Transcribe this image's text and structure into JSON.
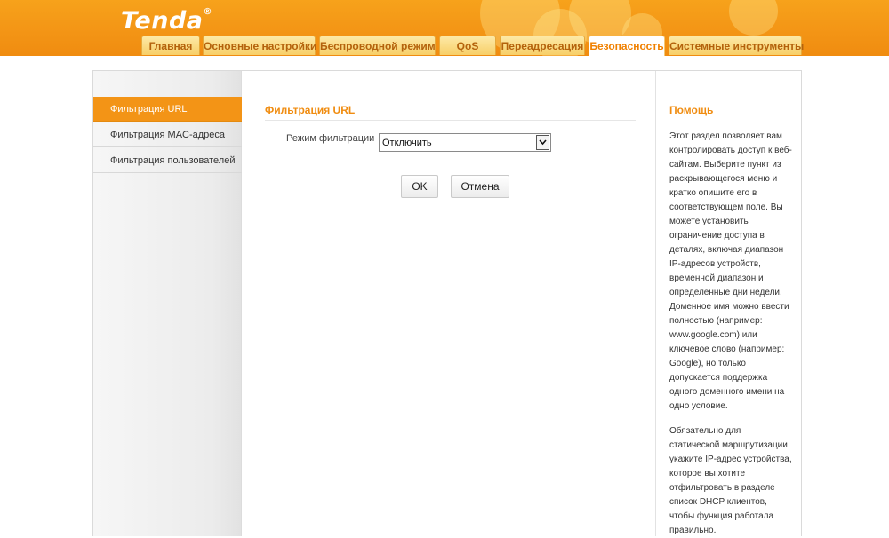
{
  "header": {
    "logo": "Tenda",
    "logo_mark": "®",
    "tabs": [
      {
        "label": "Главная"
      },
      {
        "label": "Основные настройки"
      },
      {
        "label": "Беспроводной режим"
      },
      {
        "label": "QoS"
      },
      {
        "label": "Переадресация"
      },
      {
        "label": "Безопасность",
        "active": true
      },
      {
        "label": "Системные инструменты"
      }
    ]
  },
  "sidebar": {
    "items": [
      {
        "label": "Фильтрация URL",
        "active": true
      },
      {
        "label": "Фильтрация MAC-адреса"
      },
      {
        "label": "Фильтрация пользователей"
      }
    ]
  },
  "main": {
    "title": "Фильтрация URL",
    "filter_mode_label": "Режим фильтрации",
    "filter_mode_value": "Отключить",
    "ok_label": "OK",
    "cancel_label": "Отмена"
  },
  "help": {
    "title": "Помощь",
    "paragraph1": "Этот раздел позволяет вам\nконтролировать доступ к веб-\nсайтам. Выберите пункт из\nраскрывающегося меню и\nкратко опишите его в\nсоответствующем поле. Вы\nможете установить\nограничение доступа в\nдеталях, включая диапазон\nIP-адресов устройств,\nвременной диапазон и\nопределенные дни недели.\nДоменное имя можно ввести\nполностью (например:\nwww.google.com) или\nключевое слово (например:\nGoogle), но только\nдопускается поддержка\nодного доменного имени на\nодно условие.",
    "paragraph2": "Обязательно для\nстатической маршрутизации\nукажите IP-адрес устройства,\nкоторое вы хотите\nотфильтровать в разделе\nсписок DHCP клиентов,\nчтобы функция работала\nправильно."
  },
  "colors": {
    "accent": "#f39416",
    "header_bg": "#f39415",
    "title_text": "#f08c10"
  }
}
